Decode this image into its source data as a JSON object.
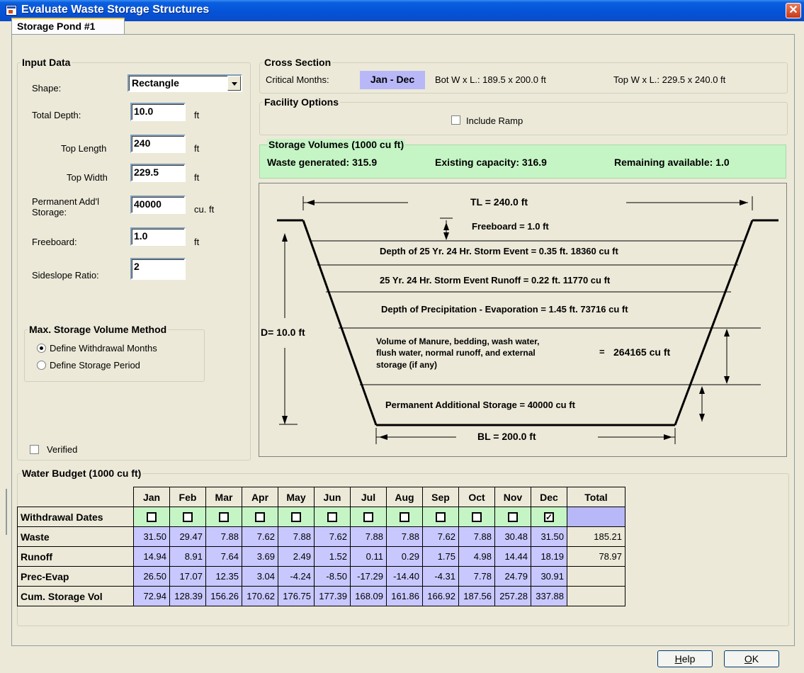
{
  "window": {
    "title": "Evaluate Waste Storage Structures",
    "close_label": "✕"
  },
  "tab": {
    "label": "Storage Pond #1"
  },
  "input_data": {
    "legend": "Input Data",
    "shape_label": "Shape:",
    "shape_value": "Rectangle",
    "total_depth_label": "Total Depth:",
    "total_depth_value": "10.0",
    "total_depth_unit": "ft",
    "top_length_label": "Top Length",
    "top_length_value": "240",
    "top_length_unit": "ft",
    "top_width_label": "Top Width",
    "top_width_value": "229.5",
    "top_width_unit": "ft",
    "perm_storage_label_1": "Permanent Add'l",
    "perm_storage_label_2": "Storage:",
    "perm_storage_value": "40000",
    "perm_storage_unit": "cu. ft",
    "freeboard_label": "Freeboard:",
    "freeboard_value": "1.0",
    "freeboard_unit": "ft",
    "sideslope_label": "Sideslope Ratio:",
    "sideslope_value": "2",
    "method_legend": "Max. Storage Volume Method",
    "method_option_1": "Define Withdrawal Months",
    "method_option_2": "Define Storage Period",
    "verified_label": "Verified"
  },
  "cross_section": {
    "legend": "Cross Section",
    "critical_label": "Critical Months:",
    "critical_value": "Jan - Dec",
    "bot_label": "Bot W x L.: 189.5 x 200.0 ft",
    "top_label": "Top W x L.: 229.5 x 240.0 ft"
  },
  "facility": {
    "legend": "Facility Options",
    "ramp_label": "Include Ramp"
  },
  "storage_volumes": {
    "legend": "Storage Volumes (1000 cu ft)",
    "waste": "Waste generated: 315.9",
    "existing": "Existing capacity: 316.9",
    "remaining": "Remaining available: 1.0"
  },
  "diagram": {
    "tl": "TL = 240.0 ft",
    "freeboard": "Freeboard =  1.0 ft",
    "storm_depth": "Depth of 25 Yr. 24 Hr. Storm Event =  0.35 ft.  18360 cu ft",
    "storm_runoff": "25 Yr. 24 Hr. Storm Event Runoff =  0.22 ft.  11770 cu ft",
    "precip": "Depth of Precipitation - Evaporation = 1.45 ft.  73716 cu ft",
    "d": "D= 10.0 ft",
    "manure_1": "Volume of Manure, bedding, wash water,",
    "manure_2": "flush water, normal runoff, and external",
    "manure_3": "storage (if any)",
    "manure_eq": "=",
    "manure_value": "264165 cu ft",
    "permanent": "Permanent Additional Storage =  40000 cu ft",
    "bl": "BL = 200.0 ft"
  },
  "water_budget": {
    "legend": "Water Budget (1000 cu ft)",
    "months": [
      "Jan",
      "Feb",
      "Mar",
      "Apr",
      "May",
      "Jun",
      "Jul",
      "Aug",
      "Sep",
      "Oct",
      "Nov",
      "Dec"
    ],
    "total_header": "Total",
    "withdrawal_label": "Withdrawal Dates",
    "withdrawal_checked": [
      false,
      false,
      false,
      false,
      false,
      false,
      false,
      false,
      false,
      false,
      false,
      true
    ],
    "rows": [
      {
        "label": "Waste",
        "values": [
          "31.50",
          "29.47",
          "7.88",
          "7.62",
          "7.88",
          "7.62",
          "7.88",
          "7.88",
          "7.62",
          "7.88",
          "30.48",
          "31.50"
        ],
        "total": "185.21"
      },
      {
        "label": "Runoff",
        "values": [
          "14.94",
          "8.91",
          "7.64",
          "3.69",
          "2.49",
          "1.52",
          "0.11",
          "0.29",
          "1.75",
          "4.98",
          "14.44",
          "18.19"
        ],
        "total": "78.97"
      },
      {
        "label": "Prec-Evap",
        "values": [
          "26.50",
          "17.07",
          "12.35",
          "3.04",
          "-4.24",
          "-8.50",
          "-17.29",
          "-14.40",
          "-4.31",
          "7.78",
          "24.79",
          "30.91"
        ],
        "total": ""
      },
      {
        "label": "Cum. Storage Vol",
        "values": [
          "72.94",
          "128.39",
          "156.26",
          "170.62",
          "176.75",
          "177.39",
          "168.09",
          "161.86",
          "166.92",
          "187.56",
          "257.28",
          "337.88"
        ],
        "total": ""
      }
    ]
  },
  "buttons": {
    "help_1": "H",
    "help_2": "elp",
    "ok_1": "O",
    "ok_2": "K"
  }
}
